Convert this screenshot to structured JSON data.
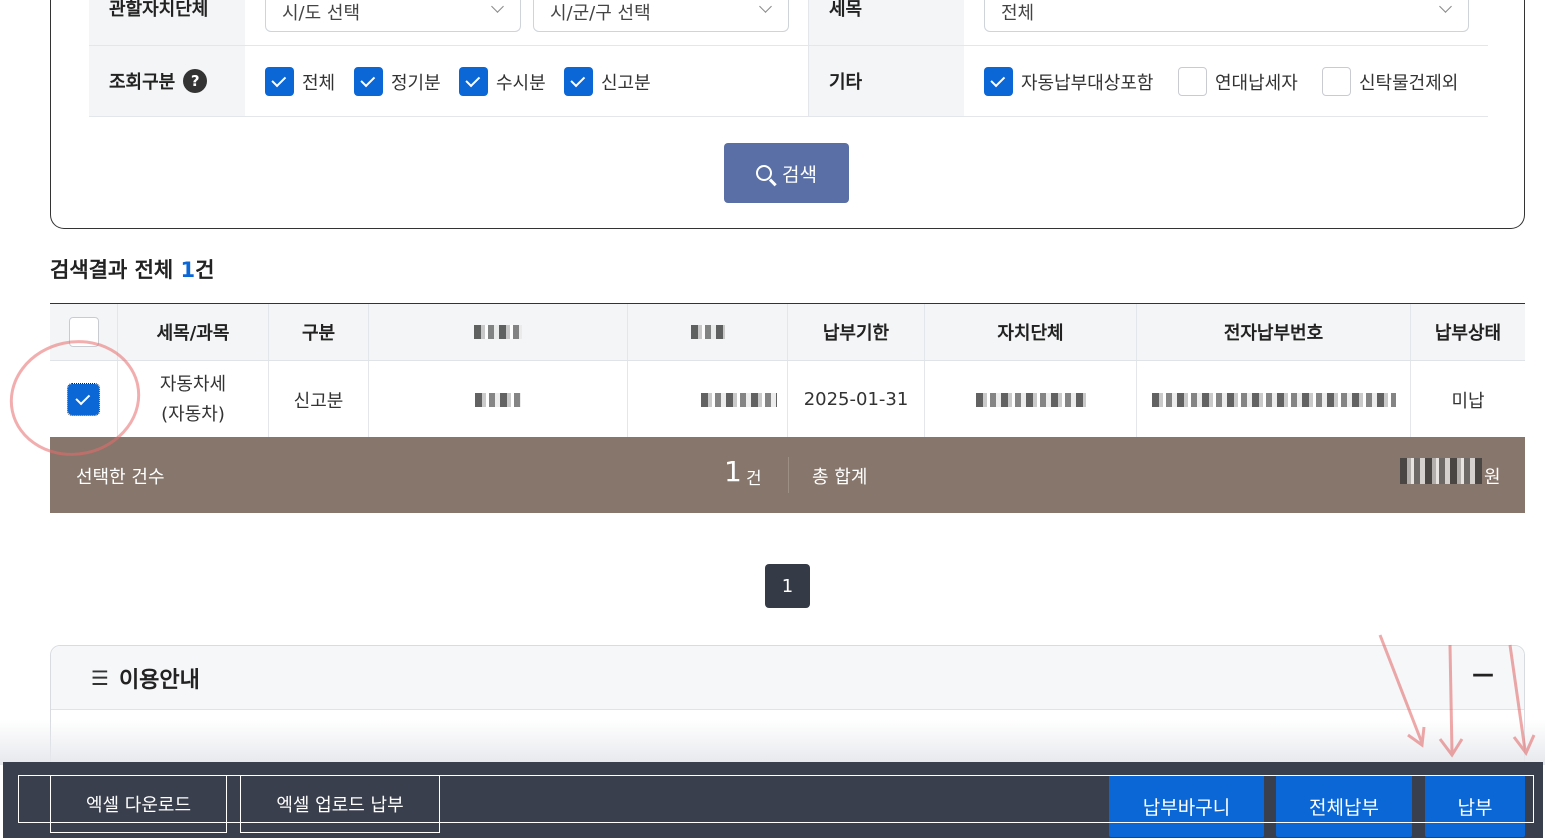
{
  "filters": {
    "jurisdiction_label": "관할자치단체",
    "sido_placeholder": "시/도 선택",
    "sigungu_placeholder": "시/군/구 선택",
    "tax_item_label": "세목",
    "tax_item_value": "전체",
    "query_type_label": "조회구분",
    "query_help": "?",
    "query_options": [
      "전체",
      "정기분",
      "수시분",
      "신고분"
    ],
    "etc_label": "기타",
    "etc_options": [
      "자동납부대상포함",
      "연대납세자",
      "신탁물건제외"
    ],
    "search_button": "검색"
  },
  "results": {
    "title_prefix": "검색결과 전체 ",
    "count": "1",
    "title_suffix": "건",
    "columns": [
      "세목/과목",
      "구분",
      "납부기한",
      "자치단체",
      "전자납부번호",
      "납부상태"
    ],
    "row": {
      "tax_item_line1": "자동차세",
      "tax_item_line2": "(자동차)",
      "category": "신고분",
      "due_date": "2025-01-31",
      "status": "미납"
    }
  },
  "summary": {
    "selected_label": "선택한 건수",
    "selected_count": "1",
    "selected_unit": "건",
    "total_label": "총 합계",
    "total_unit": "원"
  },
  "pagination": {
    "current": "1"
  },
  "guide": {
    "title": "이용안내",
    "collapse": "—"
  },
  "actions": {
    "excel_download": "엑셀 다운로드",
    "excel_upload_pay": "엑셀 업로드 납부",
    "cart": "납부바구니",
    "pay_all": "전체납부",
    "pay": "납부"
  },
  "colors": {
    "accent": "#0b67d6",
    "search_button": "#5a6fa6",
    "summary_bar": "#86766b",
    "action_bar": "#3a3f4d"
  }
}
